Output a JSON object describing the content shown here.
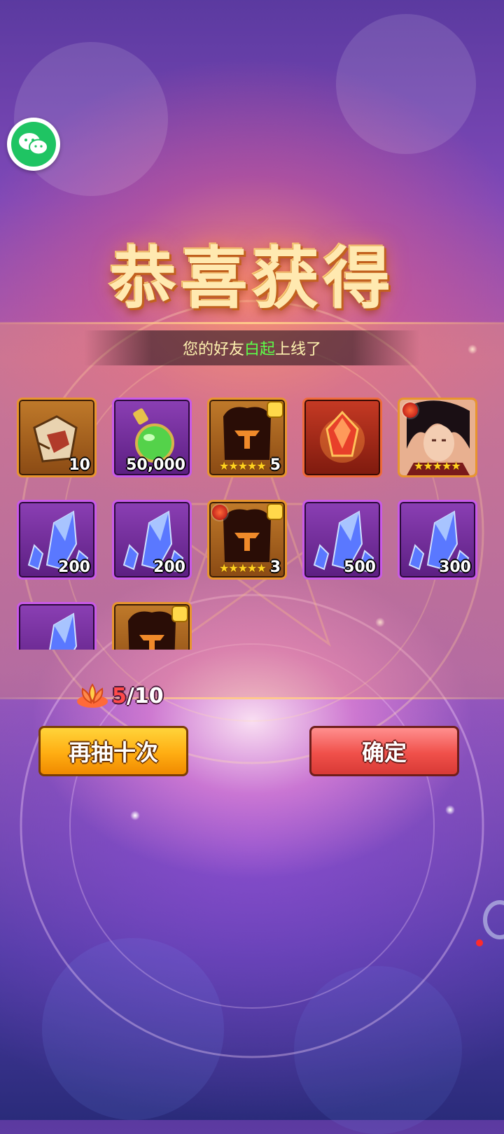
{
  "title": "恭喜获得",
  "notice": {
    "prefix": "您的好友",
    "friend_name": "白起",
    "suffix": "上线了"
  },
  "share": {
    "icon": "wechat-icon"
  },
  "rewards": [
    {
      "id": "r1",
      "kind": "item-fragment",
      "icon": "scroll-fragment-icon",
      "frame": "orange",
      "count": "10"
    },
    {
      "id": "r2",
      "kind": "potion",
      "icon": "green-potion-icon",
      "frame": "purple",
      "count": "50,000"
    },
    {
      "id": "r3",
      "kind": "hero-shard",
      "icon": "helmet-shard-icon",
      "frame": "orange",
      "stars": "★★★★★",
      "star_count": "5"
    },
    {
      "id": "r4",
      "kind": "gem",
      "icon": "fire-gem-icon",
      "frame": "red",
      "count": ""
    },
    {
      "id": "r5",
      "kind": "hero",
      "icon": "hero-portrait-icon",
      "frame": "orange",
      "stars": "★★★★★"
    },
    {
      "id": "r6",
      "kind": "crystal",
      "icon": "blue-crystal-icon",
      "frame": "purple",
      "count": "200"
    },
    {
      "id": "r7",
      "kind": "crystal",
      "icon": "blue-crystal-icon",
      "frame": "purple",
      "count": "200"
    },
    {
      "id": "r8",
      "kind": "hero-shard",
      "icon": "helmet-shard-icon",
      "frame": "orange",
      "stars": "★★★★★",
      "star_count": "3"
    },
    {
      "id": "r9",
      "kind": "crystal",
      "icon": "blue-crystal-icon",
      "frame": "purple",
      "count": "500"
    },
    {
      "id": "r10",
      "kind": "crystal",
      "icon": "blue-crystal-icon",
      "frame": "purple",
      "count": "300"
    },
    {
      "id": "r11",
      "kind": "crystal",
      "icon": "blue-crystal-icon",
      "frame": "purple",
      "count": ""
    },
    {
      "id": "r12",
      "kind": "hero-shard",
      "icon": "helmet-shard-icon",
      "frame": "orange",
      "count": ""
    }
  ],
  "counter": {
    "icon": "lotus-token-icon",
    "current": "5",
    "total": "/10"
  },
  "buttons": {
    "again": "再抽十次",
    "confirm": "确定"
  },
  "colors": {
    "highlight_name": "#5dff4a",
    "button_again": "#ffad12",
    "button_confirm": "#f0504a"
  }
}
